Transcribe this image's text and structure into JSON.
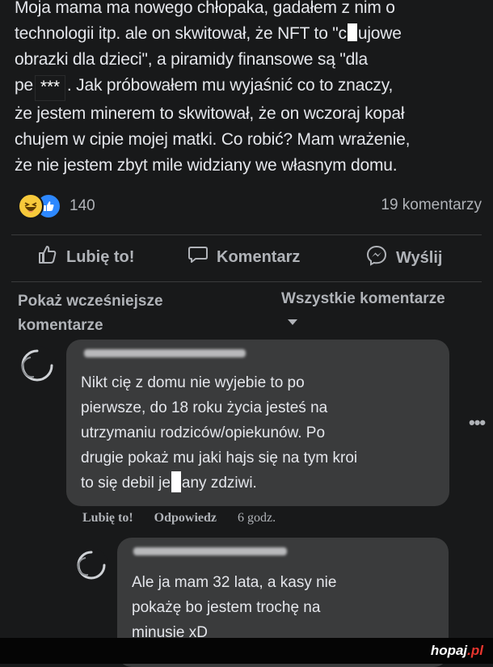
{
  "post": {
    "line1": "Moja mama ma nowego chłopaka, gadałem z nim o",
    "line2": "technologii itp. ale on skwitował, że NFT to \"c",
    "line2b": "ujowe",
    "line3": "obrazki dla dzieci\", a piramidy finansowe są \"dla",
    "line4a": "pe",
    "line4_stars": "***",
    "line4b": ". Jak próbowałem mu wyjaśnić co to znaczy,",
    "line5": "że jestem minerem to skwitował, że on wczoraj kopał",
    "line6": "chujem w cipie mojej matki. Co robić? Mam wrażenie,",
    "line7": "że nie jestem zbyt mile widziany we własnym domu."
  },
  "stats": {
    "reaction_count": "140",
    "comment_count": "19 komentarzy"
  },
  "actions": {
    "like": "Lubię to!",
    "comment": "Komentarz",
    "send": "Wyślij"
  },
  "comments_header": {
    "earlier": "Pokaż wcześniejsze komentarze",
    "all": "Wszystkie komentarze"
  },
  "comment1": {
    "line1": "Nikt cię z domu nie wyjebie to po",
    "line2": "pierwsze, do 18 roku życia jesteś na",
    "line3": "utrzymaniu rodziców/opiekunów. Po",
    "line4": "drugie pokaż mu jaki hajs się na tym kroi",
    "line5a": "to się debil je",
    "line5b": "any zdziwi.",
    "like": "Lubię to!",
    "reply": "Odpowiedz",
    "time": "6 godz."
  },
  "comment2": {
    "line1": "Ale ja mam 32 lata, a kasy nie",
    "line2": "pokażę bo jestem trochę na",
    "line3": "minusie xD"
  },
  "watermark": {
    "main": "hopaj",
    "tld": ".pl"
  },
  "colors": {
    "background": "#18191a",
    "bubble": "#3a3b3c",
    "text": "#e4e6eb",
    "secondary": "#b0b3b8",
    "like_blue": "#2d88ff",
    "haha_yellow": "#f7c93b",
    "watermark_red": "#e8352e"
  }
}
